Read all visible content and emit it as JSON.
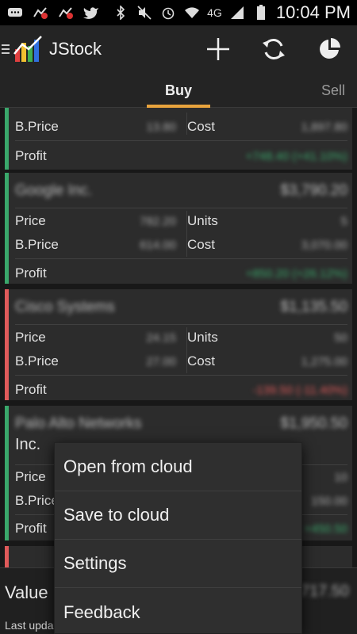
{
  "status_bar": {
    "time": "10:04 PM",
    "network": "4G"
  },
  "app": {
    "title": "JStock",
    "menu_icon": "hamburger-icon",
    "logo_icon": "chart-logo-icon",
    "actions": [
      {
        "name": "add",
        "icon": "plus-icon"
      },
      {
        "name": "refresh",
        "icon": "refresh-icon"
      },
      {
        "name": "pie",
        "icon": "pie-chart-icon"
      }
    ]
  },
  "tabs": {
    "buy": "Buy",
    "sell": "Sell",
    "active": "buy",
    "accent_color": "#e8a33d"
  },
  "labels": {
    "price": "Price",
    "bprice": "B.Price",
    "units": "Units",
    "cost": "Cost",
    "profit": "Profit"
  },
  "cards": [
    {
      "status_color": "#3aa86b",
      "bprice": "13.80",
      "cost": "1,897.80",
      "profit": "+748.40 (+41.10%)"
    },
    {
      "status_color": "#3aa86b",
      "title": "Google Inc.",
      "value": "$3,790.20",
      "price": "782.20",
      "units": "5",
      "bprice": "614.00",
      "cost": "3,070.00",
      "profit": "+850.20 (+26.12%)"
    },
    {
      "status_color": "#e05a5a",
      "title": "Cisco Systems",
      "value": "$1,135.50",
      "price": "24.15",
      "units": "50",
      "bprice": "27.00",
      "cost": "1,275.00",
      "profit": "-139.50 (-11.40%)"
    },
    {
      "status_color": "#3aa86b",
      "title": "Palo Alto Networks",
      "title_line2": "Inc.",
      "value": "$1,950.50",
      "units": "10",
      "bprice": "150.00",
      "profit": "+450.50"
    }
  ],
  "summary": {
    "value_label": "Value",
    "value": "$7,717.50",
    "updated_label": "Last upda"
  },
  "popup_menu": {
    "items": [
      "Open from cloud",
      "Save to cloud",
      "Settings",
      "Feedback"
    ]
  }
}
